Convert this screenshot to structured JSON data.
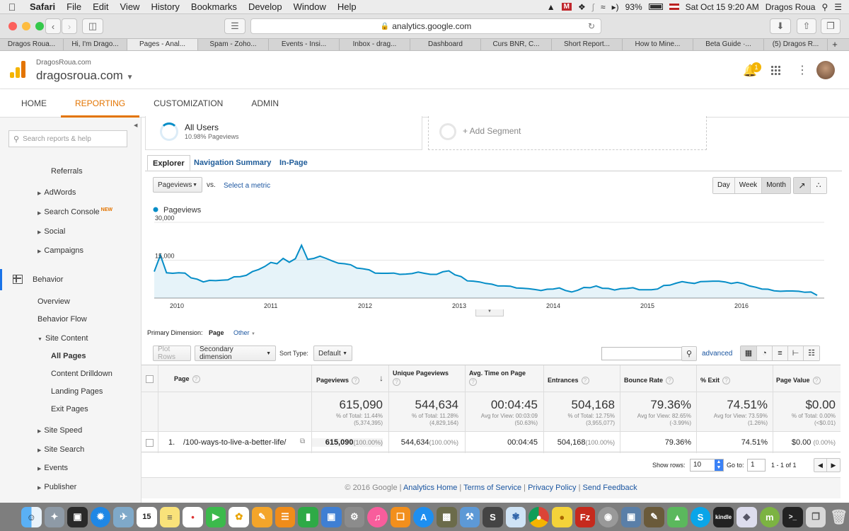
{
  "menubar": {
    "app": "Safari",
    "items": [
      "File",
      "Edit",
      "View",
      "History",
      "Bookmarks",
      "Develop",
      "Window",
      "Help"
    ],
    "battery": "93%",
    "datetime": "Sat Oct 15  9:20 AM",
    "user": "Dragos Roua"
  },
  "browser": {
    "url": "analytics.google.com",
    "tabs": [
      "Dragos Roua...",
      "Hi, I'm Drago...",
      "Pages - Anal...",
      "Spam - Zoho...",
      "Events - Insi...",
      "Inbox - drag...",
      "Dashboard",
      "Curs BNR, C...",
      "Short Report...",
      "How to Mine...",
      "Beta Guide ·...",
      "(5) Dragos R..."
    ],
    "active_tab": 2
  },
  "header": {
    "account": "DragosRoua.com",
    "property": "dragosroua.com",
    "notifications": "1"
  },
  "nav": {
    "items": [
      "HOME",
      "REPORTING",
      "CUSTOMIZATION",
      "ADMIN"
    ],
    "active": 1
  },
  "sidebar": {
    "search_placeholder": "Search reports & help",
    "items": [
      {
        "label": "Referrals",
        "level": 2
      },
      {
        "label": "AdWords",
        "level": 1
      },
      {
        "label": "Search Console",
        "level": 1,
        "badge": "NEW"
      },
      {
        "label": "Social",
        "level": 1
      },
      {
        "label": "Campaigns",
        "level": 1
      },
      {
        "label": "Behavior",
        "level": 0
      },
      {
        "label": "Overview",
        "level": 1
      },
      {
        "label": "Behavior Flow",
        "level": 1
      },
      {
        "label": "Site Content",
        "level": 1
      },
      {
        "label": "All Pages",
        "level": 2
      },
      {
        "label": "Content Drilldown",
        "level": 2
      },
      {
        "label": "Landing Pages",
        "level": 2
      },
      {
        "label": "Exit Pages",
        "level": 2
      },
      {
        "label": "Site Speed",
        "level": 1
      },
      {
        "label": "Site Search",
        "level": 1
      },
      {
        "label": "Events",
        "level": 1
      },
      {
        "label": "Publisher",
        "level": 1
      }
    ]
  },
  "segments": {
    "all_users": "All Users",
    "all_users_sub": "10.98% Pageviews",
    "add": "+ Add Segment"
  },
  "subtabs": [
    "Explorer",
    "Navigation Summary",
    "In-Page"
  ],
  "controls": {
    "metric": "Pageviews",
    "vs": "vs.",
    "select_metric": "Select a metric",
    "periods": [
      "Day",
      "Week",
      "Month"
    ],
    "active_period": "Month"
  },
  "chart_data": {
    "type": "area",
    "series": [
      {
        "name": "Pageviews",
        "color": "#058dc7"
      }
    ],
    "y_ticks": [
      "30,000",
      "15,000"
    ],
    "ylim": [
      0,
      30000
    ],
    "x_ticks": [
      "2010",
      "2011",
      "2012",
      "2013",
      "2014",
      "2015",
      "2016"
    ],
    "values": [
      10500,
      17000,
      10000,
      9800,
      10000,
      9900,
      8000,
      7500,
      6400,
      7000,
      6900,
      7100,
      7200,
      8400,
      8500,
      9000,
      10500,
      11300,
      12500,
      14100,
      13600,
      15700,
      14200,
      15600,
      20900,
      15300,
      15700,
      16600,
      15700,
      14700,
      13800,
      13600,
      13200,
      11900,
      11600,
      11200,
      9900,
      9800,
      9800,
      9900,
      9400,
      9500,
      9700,
      10300,
      9800,
      9400,
      9400,
      10400,
      10800,
      9200,
      8500,
      6800,
      6700,
      6400,
      5800,
      5500,
      4800,
      4800,
      4700,
      4000,
      3900,
      3700,
      3400,
      3000,
      3500,
      3600,
      4000,
      3000,
      2400,
      3100,
      4200,
      4100,
      4800,
      3900,
      3800,
      3200,
      3700,
      3800,
      4100,
      3300,
      3300,
      3300,
      3600,
      5000,
      5100,
      5900,
      6500,
      6100,
      5800,
      6500,
      6600,
      6700,
      6700,
      6400,
      5800,
      6200,
      5700,
      4800,
      4300,
      3600,
      3500,
      2900,
      2700,
      2800,
      2800,
      2700,
      2300,
      2400,
      1100
    ]
  },
  "dimension": {
    "label": "Primary Dimension:",
    "current": "Page",
    "other": "Other"
  },
  "table_controls": {
    "plot_rows": "Plot Rows",
    "secondary": "Secondary dimension",
    "sort_label": "Sort Type:",
    "sort_value": "Default",
    "advanced": "advanced"
  },
  "table": {
    "columns": [
      "Page",
      "Pageviews",
      "Unique Pageviews",
      "Avg. Time on Page",
      "Entrances",
      "Bounce Rate",
      "% Exit",
      "Page Value"
    ],
    "totals": [
      {
        "value": "615,090",
        "line1": "% of Total: 11.44%",
        "line2": "(5,374,395)"
      },
      {
        "value": "544,634",
        "line1": "% of Total: 11.28%",
        "line2": "(4,829,164)"
      },
      {
        "value": "00:04:45",
        "line1": "Avg for View: 00:03:09",
        "line2": "(50.63%)"
      },
      {
        "value": "504,168",
        "line1": "% of Total: 12.75%",
        "line2": "(3,955,077)"
      },
      {
        "value": "79.36%",
        "line1": "Avg for View: 82.65%",
        "line2": "(-3.99%)"
      },
      {
        "value": "74.51%",
        "line1": "Avg for View: 73.59%",
        "line2": "(1.26%)"
      },
      {
        "value": "$0.00",
        "line1": "% of Total: 0.00%",
        "line2": "(<$0.01)"
      }
    ],
    "rows": [
      {
        "index": "1.",
        "page": "/100-ways-to-live-a-better-life/",
        "cells": [
          {
            "v": "615,090",
            "p": "(100.00%)"
          },
          {
            "v": "544,634",
            "p": "(100.00%)"
          },
          {
            "v": "00:04:45",
            "p": ""
          },
          {
            "v": "504,168",
            "p": "(100.00%)"
          },
          {
            "v": "79.36%",
            "p": ""
          },
          {
            "v": "74.51%",
            "p": ""
          },
          {
            "v": "$0.00",
            "p": "(0.00%)"
          }
        ]
      }
    ]
  },
  "pagination": {
    "show_rows": "Show rows:",
    "rows_value": "10",
    "goto": "Go to:",
    "goto_value": "1",
    "range": "1 - 1 of 1"
  },
  "footer": {
    "copyright": "© 2016 Google",
    "links": [
      "Analytics Home",
      "Terms of Service",
      "Privacy Policy",
      "Send Feedback"
    ]
  }
}
